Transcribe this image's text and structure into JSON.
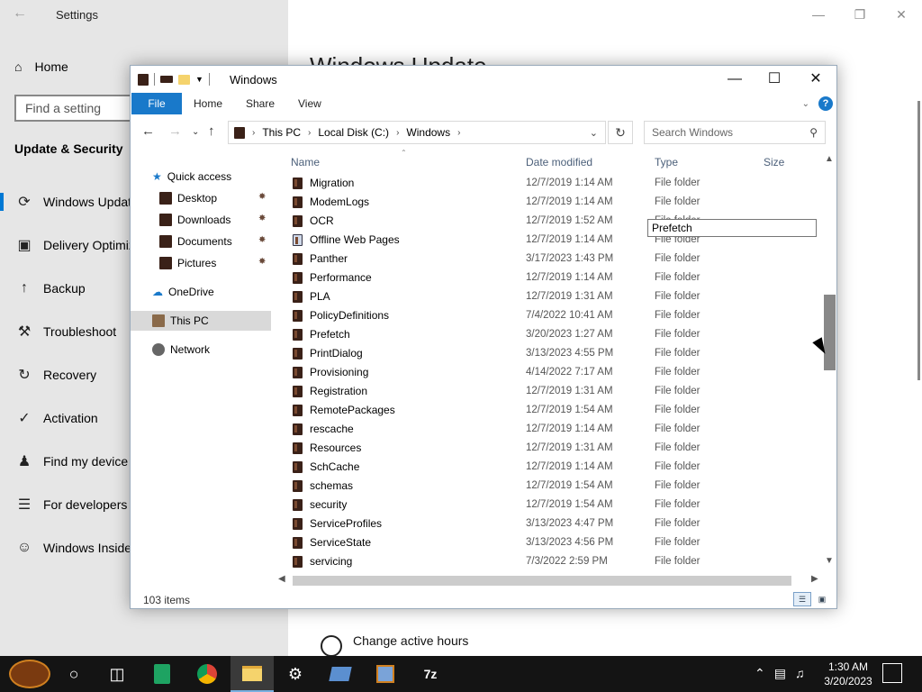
{
  "settings": {
    "title": "Settings",
    "home_label": "Home",
    "search_placeholder": "Find a setting",
    "section_title": "Update & Security",
    "nav_items": [
      {
        "label": "Windows Update",
        "icon": "sync-icon"
      },
      {
        "label": "Delivery Optimization",
        "icon": "delivery-icon"
      },
      {
        "label": "Backup",
        "icon": "backup-icon"
      },
      {
        "label": "Troubleshoot",
        "icon": "wrench-icon"
      },
      {
        "label": "Recovery",
        "icon": "recovery-icon"
      },
      {
        "label": "Activation",
        "icon": "activation-icon"
      },
      {
        "label": "Find my device",
        "icon": "person-icon"
      },
      {
        "label": "For developers",
        "icon": "dev-icon"
      },
      {
        "label": "Windows Insider Program",
        "icon": "insider-icon"
      }
    ],
    "page_title": "Windows Update",
    "change_active_hours": "Change active hours"
  },
  "explorer": {
    "title": "Windows",
    "ribbon_tabs": [
      "File",
      "Home",
      "Share",
      "View"
    ],
    "breadcrumb": [
      "This PC",
      "Local Disk (C:)",
      "Windows"
    ],
    "search_placeholder": "Search Windows",
    "nav_pane": {
      "quick_access": "Quick access",
      "pinned": [
        "Desktop",
        "Downloads",
        "Documents",
        "Pictures"
      ],
      "onedrive": "OneDrive",
      "this_pc": "This PC",
      "network": "Network"
    },
    "columns": {
      "name": "Name",
      "date": "Date modified",
      "type": "Type",
      "size": "Size"
    },
    "rows": [
      {
        "name": "Migration",
        "date": "12/7/2019 1:14 AM",
        "type": "File folder"
      },
      {
        "name": "ModemLogs",
        "date": "12/7/2019 1:14 AM",
        "type": "File folder"
      },
      {
        "name": "OCR",
        "date": "12/7/2019 1:52 AM",
        "type": "File folder"
      },
      {
        "name": "Offline Web Pages",
        "date": "12/7/2019 1:14 AM",
        "type": "File folder"
      },
      {
        "name": "Panther",
        "date": "3/17/2023 1:43 PM",
        "type": "File folder"
      },
      {
        "name": "Performance",
        "date": "12/7/2019 1:14 AM",
        "type": "File folder"
      },
      {
        "name": "PLA",
        "date": "12/7/2019 1:31 AM",
        "type": "File folder"
      },
      {
        "name": "PolicyDefinitions",
        "date": "7/4/2022 10:41 AM",
        "type": "File folder"
      },
      {
        "name": "Prefetch",
        "date": "3/20/2023 1:27 AM",
        "type": "File folder"
      },
      {
        "name": "PrintDialog",
        "date": "3/13/2023 4:55 PM",
        "type": "File folder"
      },
      {
        "name": "Provisioning",
        "date": "4/14/2022 7:17 AM",
        "type": "File folder"
      },
      {
        "name": "Registration",
        "date": "12/7/2019 1:31 AM",
        "type": "File folder"
      },
      {
        "name": "RemotePackages",
        "date": "12/7/2019 1:54 AM",
        "type": "File folder"
      },
      {
        "name": "rescache",
        "date": "12/7/2019 1:14 AM",
        "type": "File folder"
      },
      {
        "name": "Resources",
        "date": "12/7/2019 1:31 AM",
        "type": "File folder"
      },
      {
        "name": "SchCache",
        "date": "12/7/2019 1:14 AM",
        "type": "File folder"
      },
      {
        "name": "schemas",
        "date": "12/7/2019 1:54 AM",
        "type": "File folder"
      },
      {
        "name": "security",
        "date": "12/7/2019 1:54 AM",
        "type": "File folder"
      },
      {
        "name": "ServiceProfiles",
        "date": "3/13/2023 4:47 PM",
        "type": "File folder"
      },
      {
        "name": "ServiceState",
        "date": "3/13/2023 4:56 PM",
        "type": "File folder"
      },
      {
        "name": "servicing",
        "date": "7/3/2022 2:59 PM",
        "type": "File folder"
      }
    ],
    "tooltip": "Prefetch",
    "status_items": "103 items"
  },
  "taskbar": {
    "time": "1:30 AM",
    "date": "3/20/2023",
    "apps": [
      "start-icon",
      "cortana-icon",
      "task-view-icon",
      "sheets-icon",
      "chrome-icon",
      "file-explorer-icon",
      "settings-icon",
      "app-icon",
      "app2-icon",
      "7zip-icon"
    ]
  },
  "colors": {
    "accent": "#0078d4",
    "ribbon_file": "#1979ca",
    "selection": "#cce4f7",
    "taskbar": "#141414",
    "folder": "#3a2118"
  }
}
